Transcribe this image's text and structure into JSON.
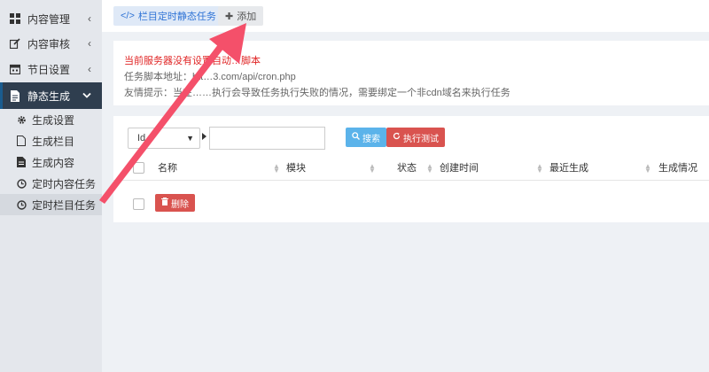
{
  "sidebar": {
    "items": [
      {
        "label": "内容管理",
        "icon": "grid-icon",
        "expanded": false
      },
      {
        "label": "内容审核",
        "icon": "edit-icon",
        "expanded": false
      },
      {
        "label": "节日设置",
        "icon": "calendar-icon",
        "expanded": false
      },
      {
        "label": "静态生成",
        "icon": "file-icon",
        "expanded": true
      }
    ],
    "sub_items": [
      {
        "label": "生成设置",
        "icon": "gear-icon"
      },
      {
        "label": "生成栏目",
        "icon": "file-outline-icon"
      },
      {
        "label": "生成内容",
        "icon": "file-icon"
      },
      {
        "label": "定时内容任务",
        "icon": "clock-icon"
      },
      {
        "label": "定时栏目任务",
        "icon": "clock-icon"
      }
    ]
  },
  "tabs": {
    "current": "栏目定时静态任务",
    "add": "添加"
  },
  "notice": {
    "warning": "当前服务器没有设置自动…脚本",
    "script_label": "任务脚本地址：",
    "script_url": "htt…3.com/api/cron.php",
    "tip": "友情提示：当在……执行会导致任务执行失败的情况，需要绑定一个非cdn域名来执行任务"
  },
  "filter": {
    "field_value": "Id",
    "keyword_value": "",
    "search_label": "搜索",
    "test_label": "执行测试"
  },
  "table": {
    "columns": [
      "名称",
      "模块",
      "状态",
      "创建时间",
      "最近生成",
      "生成情况"
    ]
  },
  "actions": {
    "delete_label": "删除"
  },
  "colors": {
    "arrow": "#f4506a",
    "sidebar_active": "#2f3e4f",
    "primary": "#3175d6",
    "danger": "#d9534f",
    "info": "#5bb3ea",
    "warning_text": "#e02424"
  }
}
